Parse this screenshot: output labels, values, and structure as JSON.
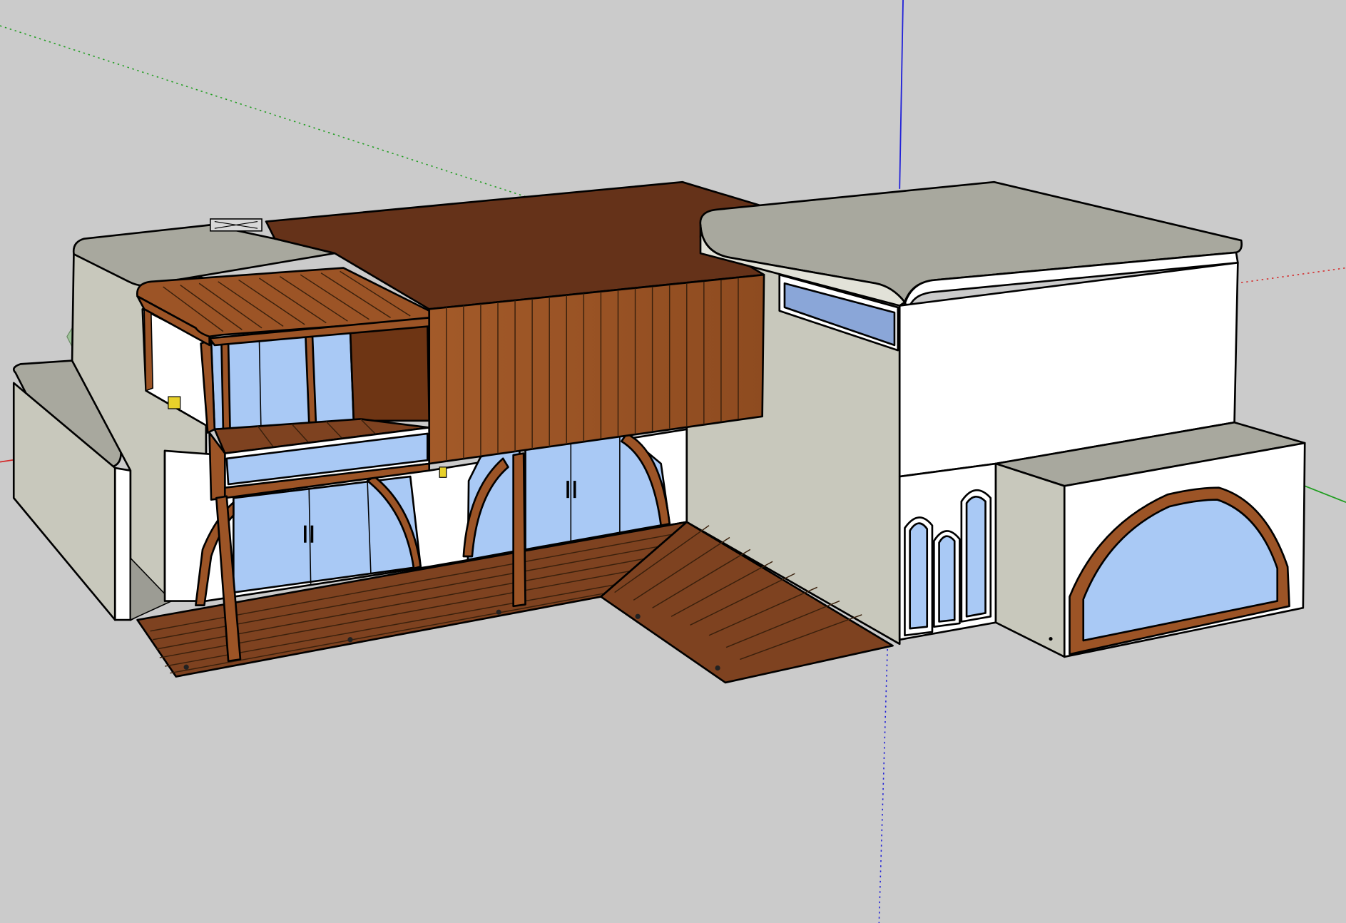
{
  "viewport": {
    "background_color": "#cbcbcb",
    "axes": {
      "red_axis_color": "#d42a2a",
      "green_axis_color": "#1f9d1f",
      "blue_axis_color": "#2020d8"
    }
  },
  "model": {
    "materials": {
      "stucco_white": "#ffffff",
      "stucco_shaded": "#c8c8bc",
      "stucco_side": "#e2e2d8",
      "roof_grey": "#a8a89e",
      "cedar_cladding": "#9c5426",
      "cedar_dark": "#6e3514",
      "deck_wood": "#7e4220",
      "roof_wood": "#653219",
      "glass": "#a9c9f5",
      "clerestory_glass": "#8aa6d8",
      "arch_trim": "#9c5426",
      "lamp": "#e8d12a"
    },
    "faces": [
      {
        "name": "left-garden-wall"
      },
      {
        "name": "left-wing-wall"
      },
      {
        "name": "left-wing-roof"
      },
      {
        "name": "balcony-pergola"
      },
      {
        "name": "upper-glazing"
      },
      {
        "name": "cedar-clad-upper-volume"
      },
      {
        "name": "wood-roof-slab"
      },
      {
        "name": "ground-floor-wall"
      },
      {
        "name": "arched-sliding-doors"
      },
      {
        "name": "front-deck"
      },
      {
        "name": "deck-stairs"
      },
      {
        "name": "tower-block"
      },
      {
        "name": "tower-roof"
      },
      {
        "name": "clerestory-window"
      },
      {
        "name": "arched-slot-windows"
      },
      {
        "name": "garage-annex"
      },
      {
        "name": "garage-arch-window"
      }
    ]
  }
}
